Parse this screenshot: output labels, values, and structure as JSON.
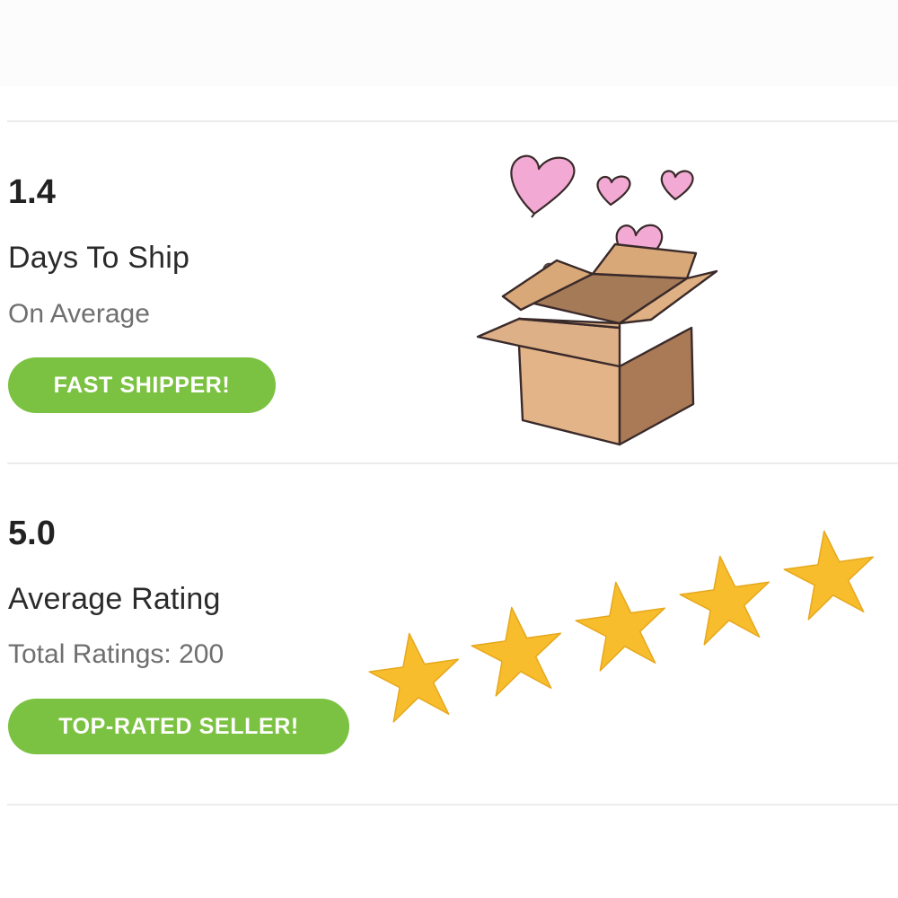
{
  "shipping": {
    "value": "1.4",
    "label": "Days To Ship",
    "sublabel": "On Average",
    "badge": "FAST SHIPPER!",
    "illustration": "box-with-hearts"
  },
  "rating": {
    "value": "5.0",
    "label": "Average Rating",
    "sublabel": "Total Ratings: 200",
    "badge": "TOP-RATED SELLER!",
    "stars": 5,
    "illustration": "five-stars"
  },
  "colors": {
    "badge_green": "#7cc242",
    "star_gold": "#f7bd2d",
    "heart_pink": "#f2a9d4",
    "box_tan": "#d9a878",
    "divider": "#ececec"
  }
}
